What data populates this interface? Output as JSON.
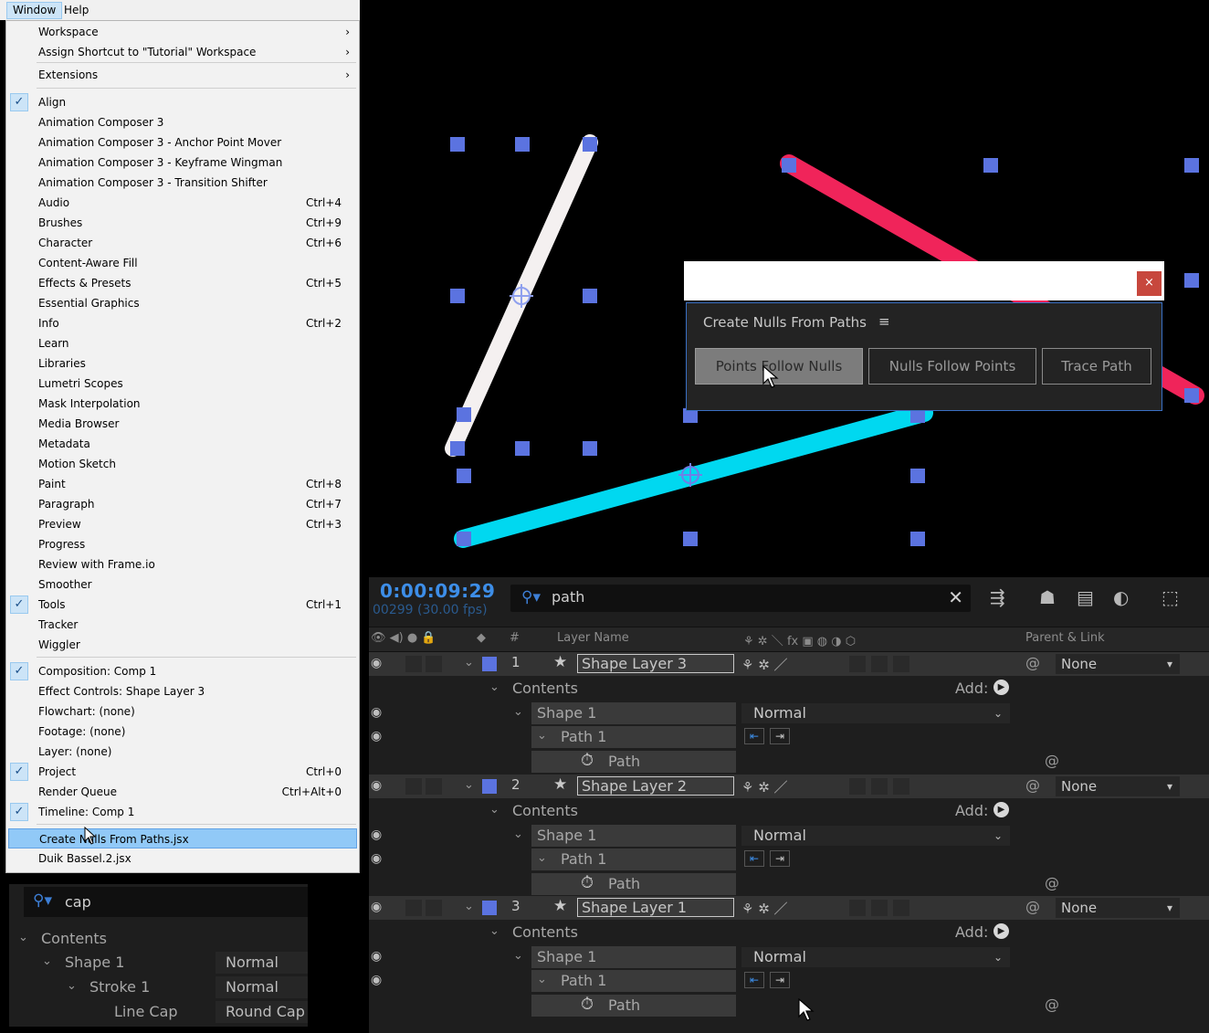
{
  "menubar": {
    "window": "Window",
    "help": "Help"
  },
  "menu": {
    "items": [
      {
        "label": "Workspace",
        "arrow": "›"
      },
      {
        "label": "Assign Shortcut to \"Tutorial\" Workspace",
        "arrow": "›"
      },
      {
        "label": "Extensions",
        "arrow": "›"
      },
      {
        "label": "Align",
        "checked": true
      },
      {
        "label": "Animation Composer 3"
      },
      {
        "label": "Animation Composer 3 - Anchor Point Mover"
      },
      {
        "label": "Animation Composer 3 - Keyframe Wingman"
      },
      {
        "label": "Animation Composer 3 - Transition Shifter"
      },
      {
        "label": "Audio",
        "shortcut": "Ctrl+4"
      },
      {
        "label": "Brushes",
        "shortcut": "Ctrl+9"
      },
      {
        "label": "Character",
        "shortcut": "Ctrl+6"
      },
      {
        "label": "Content-Aware Fill"
      },
      {
        "label": "Effects & Presets",
        "shortcut": "Ctrl+5"
      },
      {
        "label": "Essential Graphics"
      },
      {
        "label": "Info",
        "shortcut": "Ctrl+2"
      },
      {
        "label": "Learn"
      },
      {
        "label": "Libraries"
      },
      {
        "label": "Lumetri Scopes"
      },
      {
        "label": "Mask Interpolation"
      },
      {
        "label": "Media Browser"
      },
      {
        "label": "Metadata"
      },
      {
        "label": "Motion Sketch"
      },
      {
        "label": "Paint",
        "shortcut": "Ctrl+8"
      },
      {
        "label": "Paragraph",
        "shortcut": "Ctrl+7"
      },
      {
        "label": "Preview",
        "shortcut": "Ctrl+3"
      },
      {
        "label": "Progress"
      },
      {
        "label": "Review with Frame.io"
      },
      {
        "label": "Smoother"
      },
      {
        "label": "Tools",
        "shortcut": "Ctrl+1",
        "checked": true
      },
      {
        "label": "Tracker"
      },
      {
        "label": "Wiggler"
      },
      {
        "label": "Composition: Comp 1",
        "checked": true
      },
      {
        "label": "Effect Controls: Shape Layer 3"
      },
      {
        "label": "Flowchart: (none)"
      },
      {
        "label": "Footage: (none)"
      },
      {
        "label": "Layer: (none)"
      },
      {
        "label": "Project",
        "shortcut": "Ctrl+0",
        "checked": true
      },
      {
        "label": "Render Queue",
        "shortcut": "Ctrl+Alt+0"
      },
      {
        "label": "Timeline: Comp 1",
        "checked": true
      },
      {
        "label": "Create Nulls From Paths.jsx",
        "highlighted": true
      },
      {
        "label": "Duik Bassel.2.jsx"
      }
    ]
  },
  "dialog": {
    "title": "Create Nulls From Paths",
    "close": "×",
    "menu_icon": "≡",
    "buttons": [
      "Points Follow Nulls",
      "Nulls Follow Points",
      "Trace Path"
    ]
  },
  "timeline": {
    "timecode": "0:00:09:29",
    "fps": "00299 (30.00 fps)",
    "search": "path",
    "headers": {
      "hash": "#",
      "layer_name": "Layer Name",
      "parent": "Parent & Link"
    },
    "layers": [
      {
        "num": "1",
        "name": "Shape Layer 3",
        "parent": "None",
        "contents": "Contents",
        "add": "Add:",
        "shape": "Shape 1",
        "mode": "Normal",
        "path_group": "Path 1",
        "path": "Path"
      },
      {
        "num": "2",
        "name": "Shape Layer 2",
        "parent": "None",
        "contents": "Contents",
        "add": "Add:",
        "shape": "Shape 1",
        "mode": "Normal",
        "path_group": "Path 1",
        "path": "Path"
      },
      {
        "num": "3",
        "name": "Shape Layer 1",
        "parent": "None",
        "contents": "Contents",
        "add": "Add:",
        "shape": "Shape 1",
        "mode": "Normal",
        "path_group": "Path 1",
        "path": "Path"
      }
    ]
  },
  "bottom_panel": {
    "search": "cap",
    "contents": "Contents",
    "shape": "Shape 1",
    "shape_mode": "Normal",
    "stroke": "Stroke 1",
    "stroke_mode": "Normal",
    "line_cap_label": "Line Cap",
    "line_cap_value": "Round Cap"
  },
  "colors": {
    "handle": "#5b73e0",
    "white_path": "#f4f0f0",
    "pink_path": "#f0245a",
    "cyan_path": "#00d8f0",
    "timecode": "#3d8ee8",
    "menu_highlight": "#91c9f7"
  }
}
